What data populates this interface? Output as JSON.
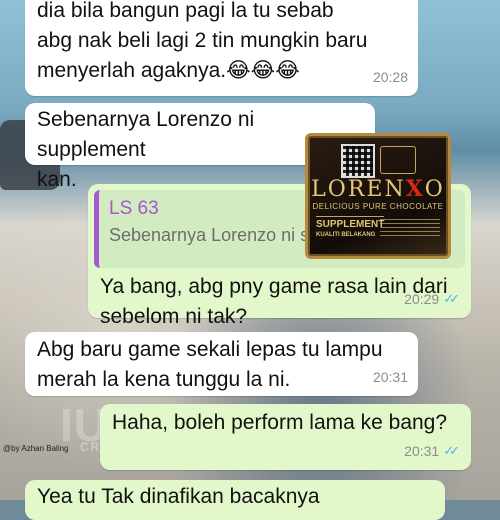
{
  "messages": [
    {
      "id": "m1",
      "direction": "incoming",
      "text": "dia bila bangun pagi la tu sebab\nabg nak beli lagi 2 tin mungkin baru\nmenyerlah agaknya.😂😂😂",
      "time": "20:28"
    },
    {
      "id": "m2",
      "direction": "incoming",
      "text": "Sebenarnya Lorenzo ni supplement\nkan.",
      "time": ""
    },
    {
      "id": "m3",
      "direction": "outgoing",
      "quote": {
        "author": "LS 63",
        "text": "Sebenarnya Lorenzo ni s"
      },
      "text": "Ya bang, abg pny game rasa lain dari\nsebelom ni tak?",
      "time": "20:29",
      "ticks": "✓✓"
    },
    {
      "id": "m4",
      "direction": "incoming",
      "text": "Abg baru game sekali lepas tu lampu\nmerah la kena tunggu la ni.",
      "time": "20:31"
    },
    {
      "id": "m5",
      "direction": "outgoing",
      "text": "Haha, boleh perform lama ke bang?",
      "time": "20:31",
      "ticks": "✓✓"
    },
    {
      "id": "m6",
      "direction": "outgoing",
      "text": "Yea tu Tak dinafikan bacaknya",
      "time": ""
    }
  ],
  "product": {
    "brand_left": "LOREN",
    "brand_x": "X",
    "brand_right": "O",
    "tagline": "DELICIOUS PURE CHOCOLATE",
    "label_line1": "SUPPLEMENT",
    "label_line2": "KUALITI BELAKANG"
  },
  "watermark": {
    "main": "IUK",
    "sub": "CREWS",
    "credit": "@by Azhan Baling"
  },
  "colors": {
    "incoming": "#ffffff",
    "outgoing": "#e2f8cb",
    "quote_accent": "#a15ad0",
    "read_ticks": "#4fb6ec"
  }
}
